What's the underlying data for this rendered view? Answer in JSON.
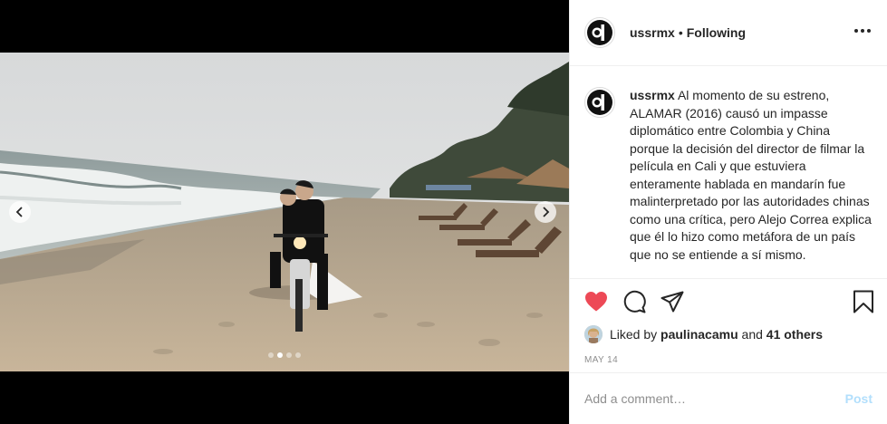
{
  "post": {
    "username": "ussrmx",
    "separator": "•",
    "follow_status": "Following",
    "caption": "Al momento de su estreno, ALAMAR (2016) causó un impasse diplomático entre Colombia y China porque la decisión del director de filmar la película en Cali y que estuviera enteramente hablada en mandarín fue malinterpretado por las autoridades chinas como una crítica, pero Alejo Correa explica que él lo hizo como metáfora de un país que no se entiende a sí mismo.",
    "carousel": {
      "count": 4,
      "active_index": 1
    }
  },
  "likes": {
    "prefix": "Liked by",
    "liker": "paulinacamu",
    "conjunction": "and",
    "others": "41 others"
  },
  "date": "MAY 14",
  "comment": {
    "placeholder": "Add a comment…",
    "post_label": "Post"
  },
  "colors": {
    "heart": "#ed4956",
    "post_disabled": "#b2dffc",
    "text": "#262626",
    "muted": "#8e8e8e"
  },
  "icons": [
    "more-options-icon",
    "heart-icon",
    "comment-icon",
    "share-icon",
    "bookmark-icon",
    "chevron-left-icon",
    "chevron-right-icon"
  ]
}
